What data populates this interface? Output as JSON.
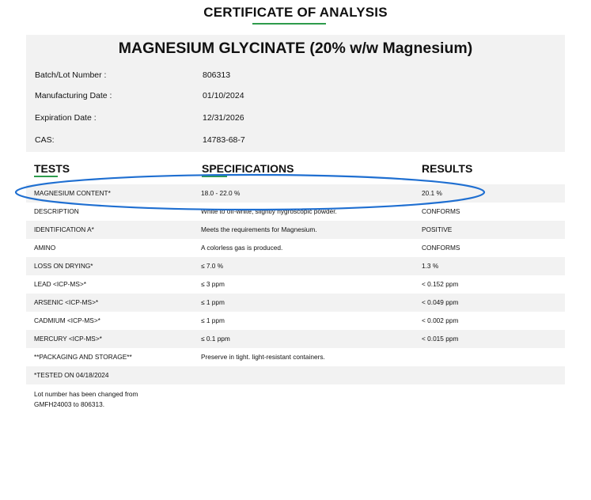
{
  "document": {
    "title": "CERTIFICATE OF ANALYSIS",
    "product_name": "MAGNESIUM GLYCINATE (20% w/w Magnesium)",
    "info": [
      {
        "label": "Batch/Lot Number :",
        "value": "806313"
      },
      {
        "label": "Manufacturing Date :",
        "value": "01/10/2024"
      },
      {
        "label": "Expiration Date :",
        "value": "12/31/2026"
      },
      {
        "label": "CAS:",
        "value": "14783-68-7"
      }
    ],
    "columns": {
      "tests": "TESTS",
      "specifications": "SPECIFICATIONS",
      "results": "RESULTS"
    },
    "rows": [
      {
        "test": "MAGNESIUM CONTENT*",
        "spec": "18.0 - 22.0 %",
        "result": "20.1 %"
      },
      {
        "test": "DESCRIPTION",
        "spec": "White to off-white, slightly hygroscopic powder.",
        "result": "CONFORMS"
      },
      {
        "test": "IDENTIFICATION A*",
        "spec": "Meets the requirements for Magnesium.",
        "result": "POSITIVE"
      },
      {
        "test": "AMINO",
        "spec": "A colorless gas is produced.",
        "result": "CONFORMS"
      },
      {
        "test": "LOSS ON DRYING*",
        "spec": "≤ 7.0 %",
        "result": "1.3 %"
      },
      {
        "test": "LEAD <ICP-MS>*",
        "spec": "≤ 3 ppm",
        "result": "< 0.152 ppm"
      },
      {
        "test": "ARSENIC <ICP-MS>*",
        "spec": "≤ 1 ppm",
        "result": "< 0.049 ppm"
      },
      {
        "test": "CADMIUM <ICP-MS>*",
        "spec": "≤ 1 ppm",
        "result": "< 0.002 ppm"
      },
      {
        "test": "MERCURY <ICP-MS>*",
        "spec": "≤ 0.1 ppm",
        "result": "< 0.015 ppm"
      },
      {
        "test": "**PACKAGING AND STORAGE**",
        "spec": "Preserve in tight. light-resistant containers.",
        "result": ""
      },
      {
        "test": "*TESTED ON 04/18/2024",
        "spec": "",
        "result": ""
      }
    ],
    "note": [
      "Lot number has been changed from",
      "GMFH24003 to 806313."
    ],
    "colors": {
      "accent_green": "#2e9b4c",
      "highlight_blue": "#1f6fd1",
      "row_shade": "#f2f2f2"
    }
  }
}
